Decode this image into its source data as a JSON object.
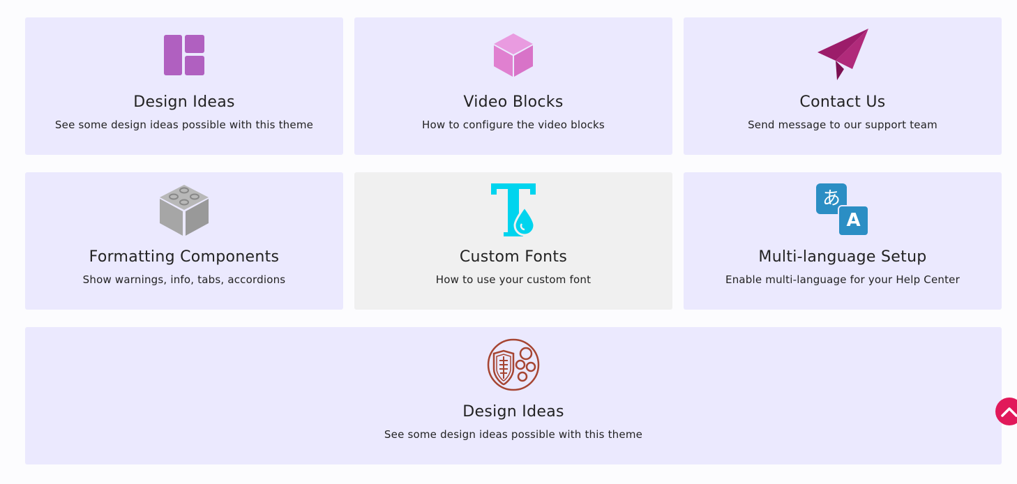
{
  "cards": [
    {
      "title": "Design Ideas",
      "desc": "See some design ideas possible with this theme",
      "icon": "layout-icon",
      "color": "#b060c0"
    },
    {
      "title": "Video Blocks",
      "desc": "How to configure the video blocks",
      "icon": "cube-icon",
      "color": "#e080d0"
    },
    {
      "title": "Contact Us",
      "desc": "Send message to our support team",
      "icon": "paper-plane-icon",
      "color": "#9c1c6a"
    },
    {
      "title": "Formatting Components",
      "desc": "Show warnings, info, tabs, accordions",
      "icon": "lego-block-icon",
      "color": "#aaaaaa"
    },
    {
      "title": "Custom Fonts",
      "desc": "How to use your custom font",
      "icon": "font-drop-icon",
      "color": "#00d4ee"
    },
    {
      "title": "Multi-language Setup",
      "desc": "Enable multi-language for your Help Center",
      "icon": "translate-icon",
      "color": "#2b8ec4",
      "glyph_a": "あ",
      "glyph_b": "A"
    },
    {
      "title": "Design Ideas",
      "desc": "See some design ideas possible with this theme",
      "icon": "shield-circles-icon",
      "color": "#a64532"
    }
  ],
  "colors": {
    "card_bg": "#ebe9fe",
    "card_hover_bg": "#f0f0f0",
    "scroll_top": "#e1195a"
  },
  "scroll_top_icon": "chevron-up-icon"
}
